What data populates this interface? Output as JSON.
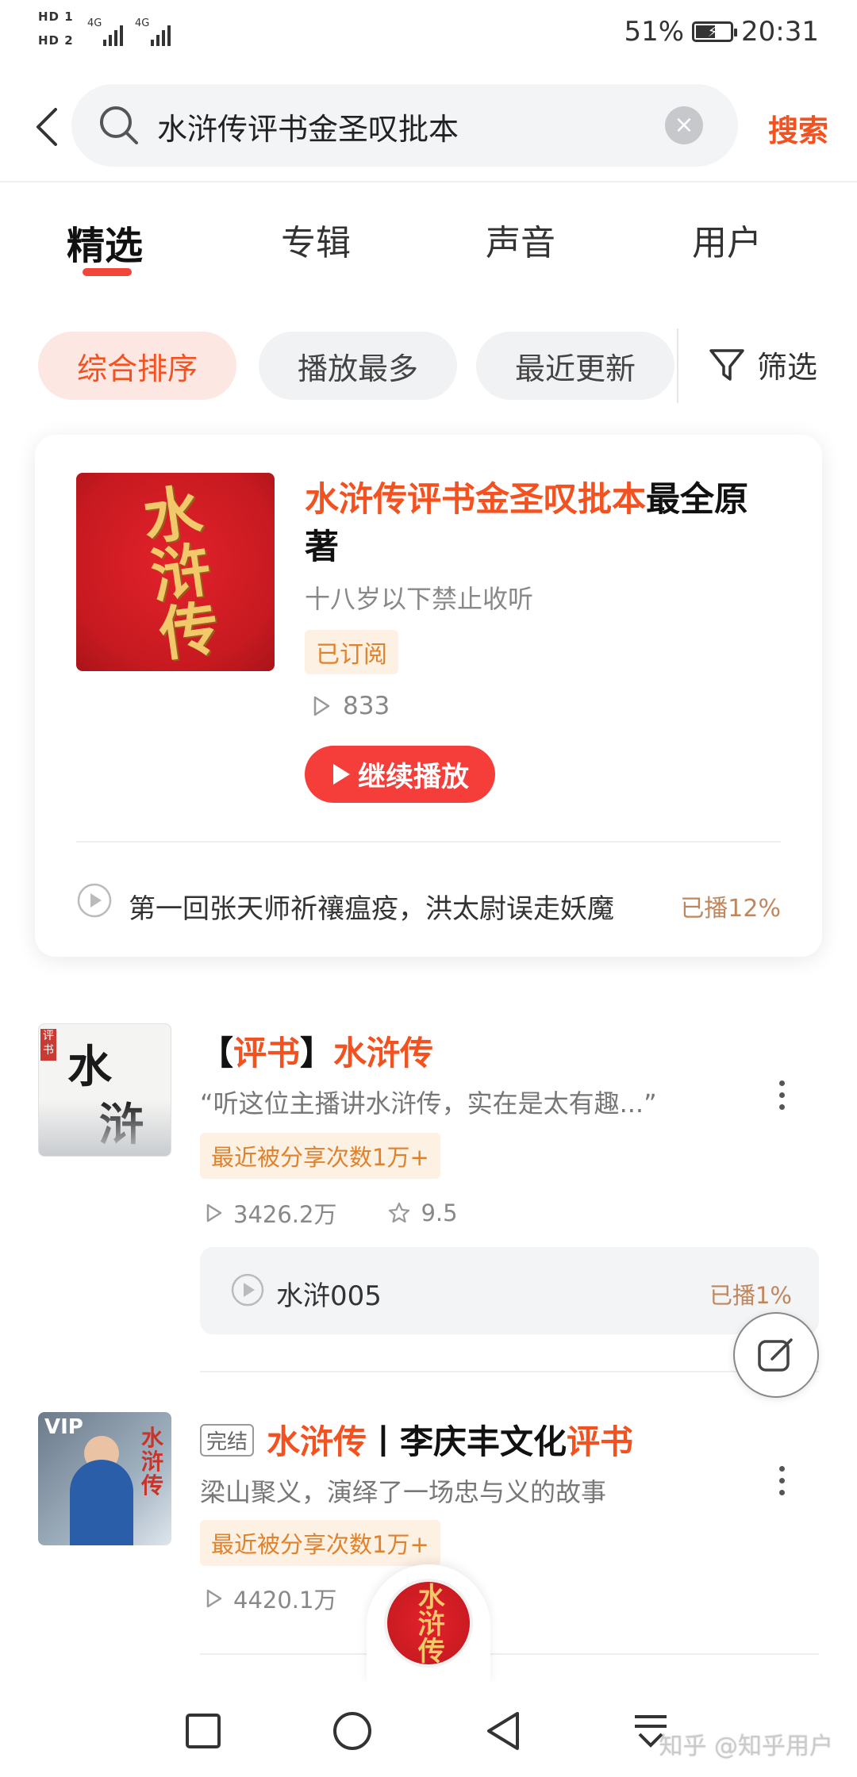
{
  "status_bar": {
    "hd1": "HD 1",
    "hd2": "HD 2",
    "signal1": "4G",
    "signal2": "4G",
    "battery_text": "51%",
    "time": "20:31"
  },
  "search": {
    "query": "水浒传评书金圣叹批本",
    "button_label": "搜索",
    "icons": {
      "back": "back-arrow-icon",
      "search": "search-icon",
      "clear": "clear-icon"
    }
  },
  "tabs": [
    {
      "label": "精选",
      "active": true
    },
    {
      "label": "专辑",
      "active": false
    },
    {
      "label": "声音",
      "active": false
    },
    {
      "label": "用户",
      "active": false
    }
  ],
  "filters": {
    "chips": [
      {
        "label": "综合排序",
        "active": true
      },
      {
        "label": "播放最多",
        "active": false
      },
      {
        "label": "最近更新",
        "active": false
      }
    ],
    "filter_label": "筛选"
  },
  "top_card": {
    "cover_text": "水浒传",
    "title_highlight": "水浒传评书金圣叹批本",
    "title_rest": "最全原著",
    "subtitle": "十八岁以下禁止收听",
    "badge": "已订阅",
    "plays": "833",
    "continue_label": "继续播放",
    "episode_title": "第一回张天师祈禳瘟疫，洪太尉误走妖魔",
    "episode_progress": "已播12%",
    "colors": {
      "accent": "#f3511f",
      "button": "#f53e3a"
    }
  },
  "results": [
    {
      "title_bracket_open": "【",
      "title_part1": "评书",
      "title_bracket_close": "】",
      "title_part2": "水浒传",
      "thumb_text1": "水",
      "thumb_text2": "浒",
      "thumb_seal": "评书",
      "description": "“听这位主播讲水浒传，实在是太有趣...”",
      "tag": "最近被分享次数1万+",
      "plays": "3426.2万",
      "rating": "9.5",
      "episode_title": "水浒005",
      "episode_progress": "已播1%"
    },
    {
      "done_tag": "完结",
      "title_hl1": "水浒传",
      "title_mid": "丨李庆丰文化",
      "title_hl2": "评书",
      "thumb_vip": "VIP",
      "thumb_title": "水浒传",
      "description": "梁山聚义，演绎了一场忠与义的故事",
      "tag": "最近被分享次数1万+",
      "plays": "4420.1万"
    }
  ],
  "floating": {
    "player_text": "水浒传",
    "edit_icon": "edit-icon"
  },
  "nav": {
    "recent": "square-icon",
    "home": "circle-icon",
    "back": "triangle-back-icon",
    "menu": "menu-down-icon"
  },
  "watermark": "知乎 @知乎用户"
}
